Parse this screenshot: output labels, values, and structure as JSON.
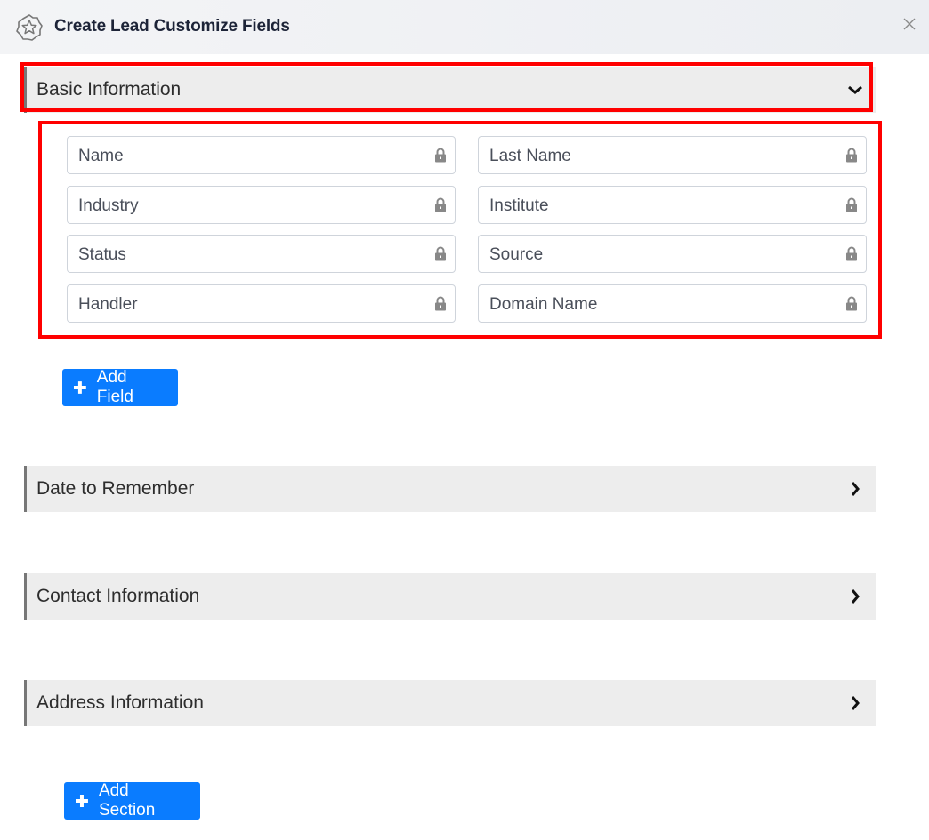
{
  "header": {
    "title": "Create Lead Customize Fields",
    "icon": "star-badge-icon",
    "close_icon": "close-icon"
  },
  "sections": [
    {
      "label": "Basic Information",
      "expanded": true,
      "chevron": "chevron-down-icon"
    },
    {
      "label": "Date to Remember",
      "expanded": false,
      "chevron": "chevron-right-icon"
    },
    {
      "label": "Contact Information",
      "expanded": false,
      "chevron": "chevron-right-icon"
    },
    {
      "label": "Address Information",
      "expanded": false,
      "chevron": "chevron-right-icon"
    }
  ],
  "basic_fields": [
    {
      "label": "Name",
      "locked": true
    },
    {
      "label": "Last Name",
      "locked": true
    },
    {
      "label": "Industry",
      "locked": true
    },
    {
      "label": "Institute",
      "locked": true
    },
    {
      "label": "Status",
      "locked": true
    },
    {
      "label": "Source",
      "locked": true
    },
    {
      "label": "Handler",
      "locked": true
    },
    {
      "label": "Domain Name",
      "locked": true
    }
  ],
  "buttons": {
    "add_field": "Add Field",
    "add_section": "Add Section"
  },
  "colors": {
    "primary": "#0a7cff",
    "highlight": "#ff0000",
    "section_bg": "#ededed"
  }
}
